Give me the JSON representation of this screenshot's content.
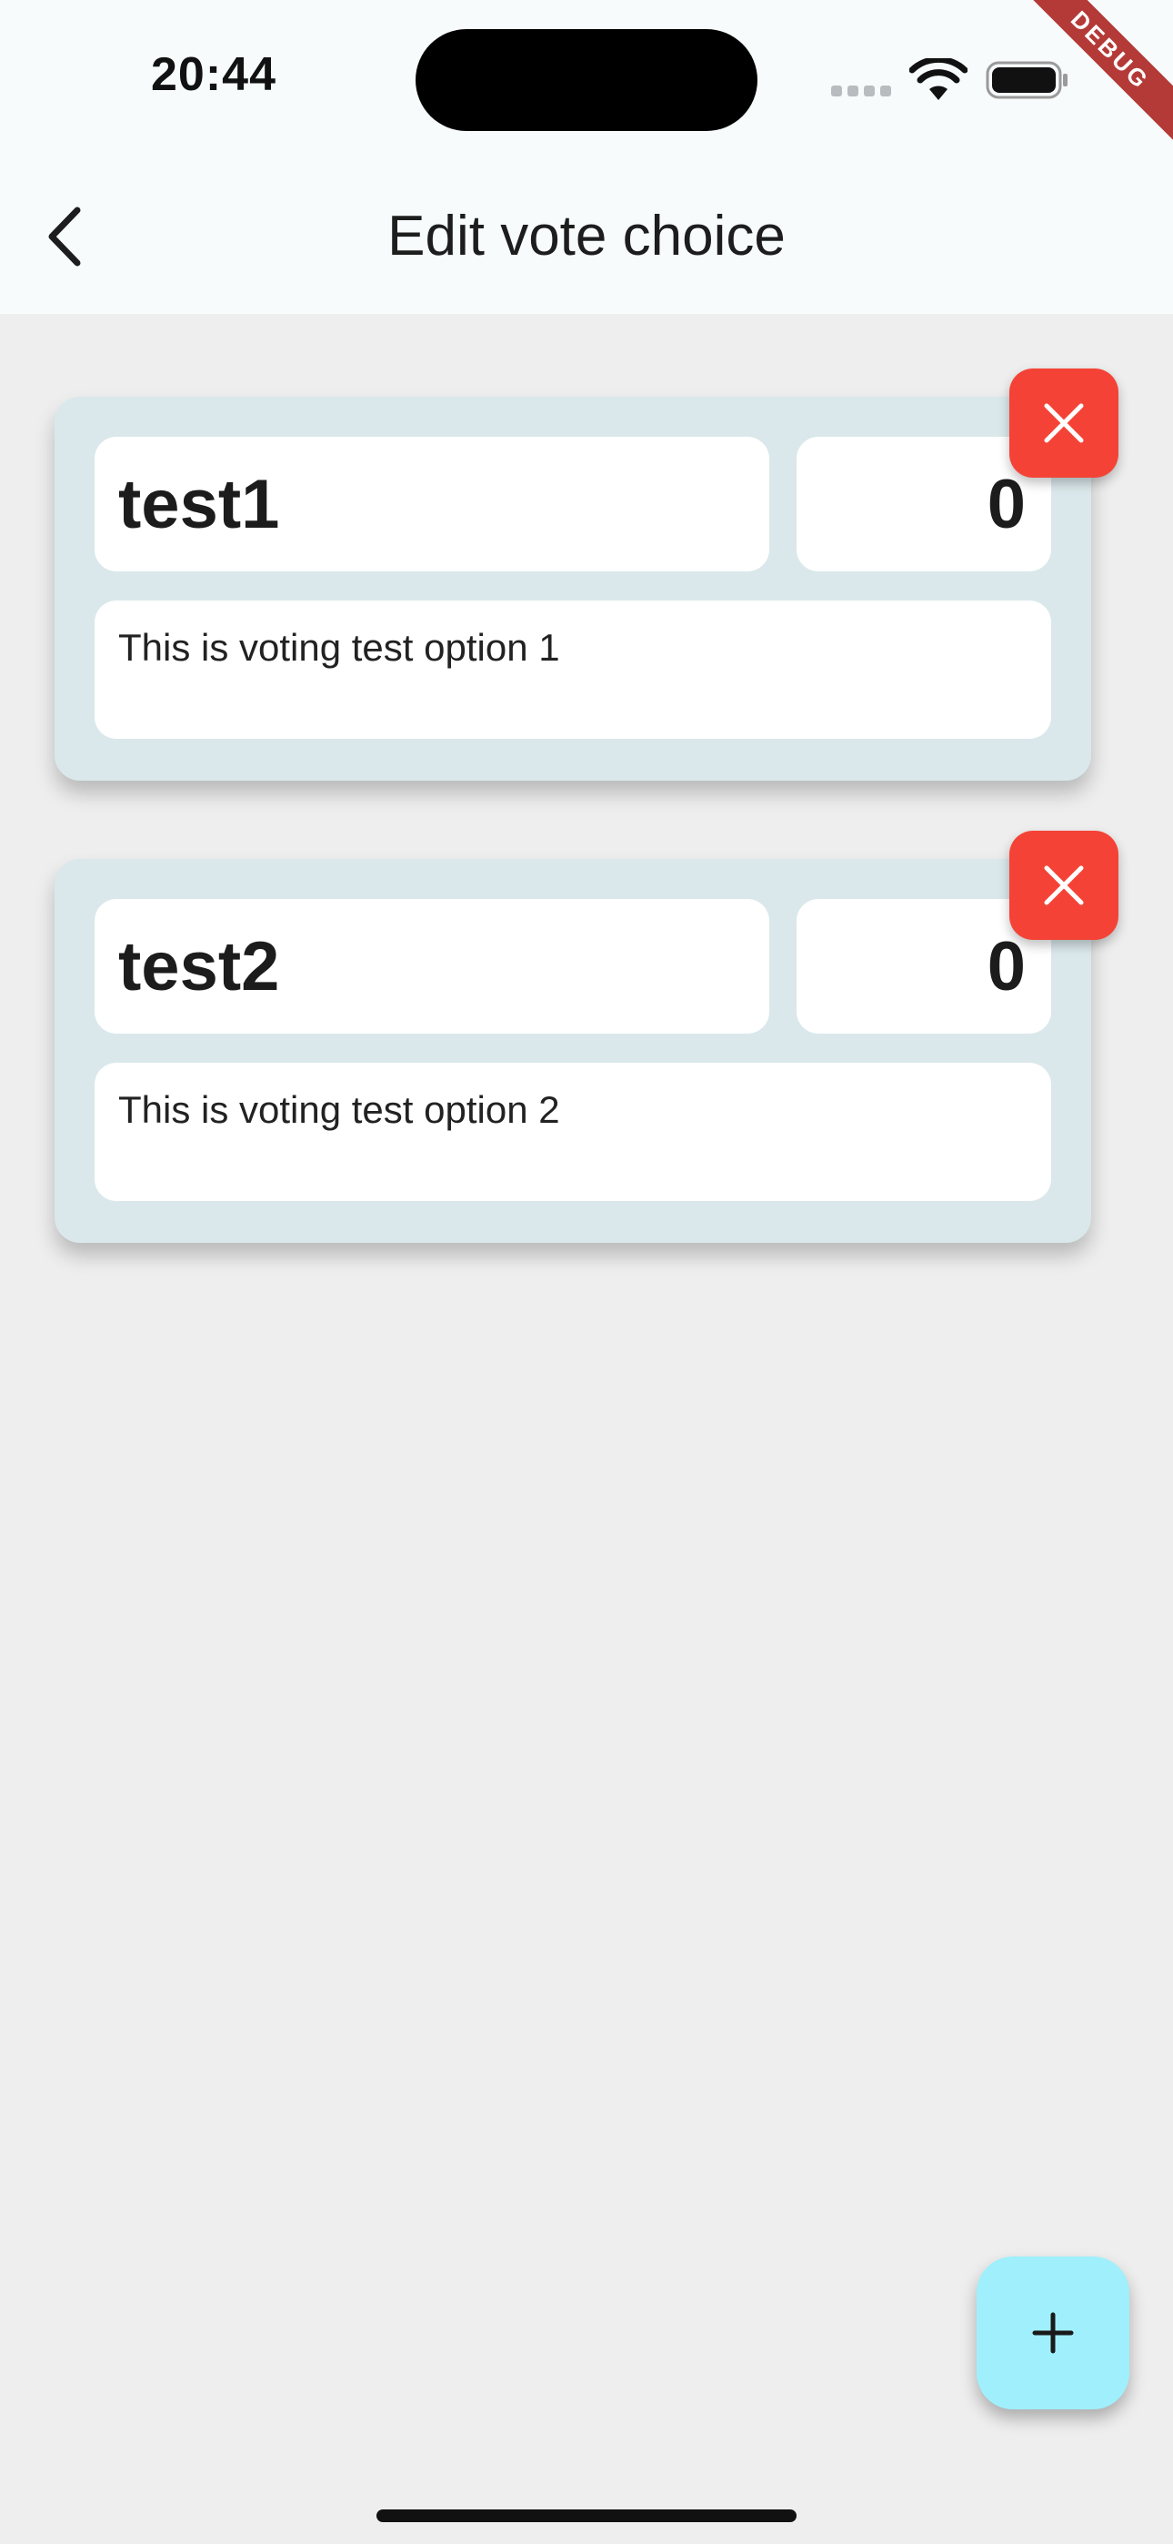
{
  "status_bar": {
    "time": "20:44"
  },
  "debug_banner": "DEBUG",
  "app_bar": {
    "title": "Edit vote choice",
    "back_icon": "chevron-left-icon"
  },
  "choices": [
    {
      "title": "test1",
      "count": "0",
      "description": "This is voting test option 1",
      "delete_icon": "close-icon"
    },
    {
      "title": "test2",
      "count": "0",
      "description": "This is voting test option 2",
      "delete_icon": "close-icon"
    }
  ],
  "fab": {
    "icon": "plus-icon"
  },
  "colors": {
    "background": "#eeeeee",
    "app_bar": "#f7fbfc",
    "card": "#dae8eb",
    "delete": "#f44336",
    "fab": "#9ff0fc",
    "debug_banner": "#b43a37"
  }
}
